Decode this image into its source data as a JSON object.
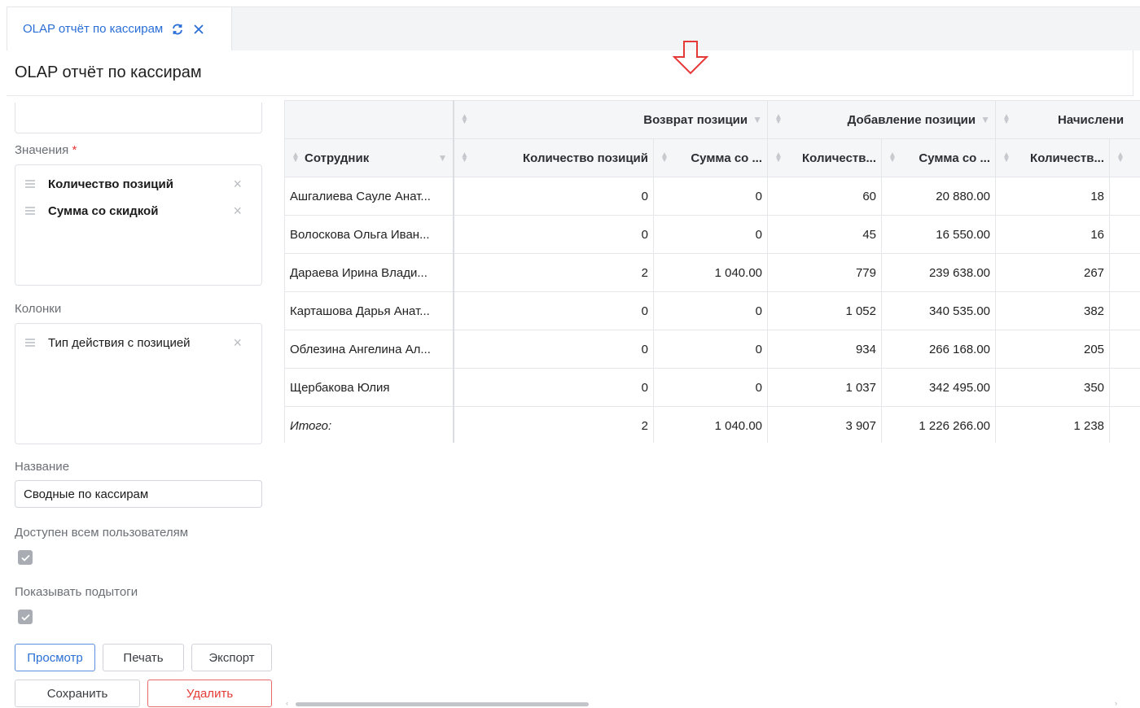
{
  "tab": {
    "label": "OLAP отчёт по кассирам",
    "refresh_icon": "refresh-icon",
    "close_icon": "close-icon"
  },
  "header": {
    "title": "OLAP отчёт по кассирам"
  },
  "panel": {
    "values_label": "Значения",
    "required_mark": "*",
    "values": [
      "Количество позиций",
      "Сумма со скидкой"
    ],
    "columns_label": "Колонки",
    "columns": [
      "Тип действия с позицией"
    ],
    "name_label": "Название",
    "name_value": "Сводные по кассирам",
    "shared_label": "Доступен всем пользователям",
    "shared_checked": true,
    "subtotals_label": "Показывать подытоги",
    "subtotals_checked": true,
    "buttons": {
      "view": "Просмотр",
      "print": "Печать",
      "export": "Экспорт",
      "save": "Сохранить",
      "delete": "Удалить"
    }
  },
  "table": {
    "groups": [
      "Возврат позиции",
      "Добавление позиции",
      "Начислени"
    ],
    "row_header": "Сотрудник",
    "columns": [
      "Количество позиций",
      "Сумма со ...",
      "Количеств...",
      "Сумма со ...",
      "Количеств..."
    ],
    "rows": [
      {
        "name": "Ашгалиева Сауле Анат...",
        "v": [
          "0",
          "0",
          "60",
          "20 880.00",
          "18"
        ]
      },
      {
        "name": "Волоскова Ольга Иван...",
        "v": [
          "0",
          "0",
          "45",
          "16 550.00",
          "16"
        ]
      },
      {
        "name": "Дараева Ирина Влади...",
        "v": [
          "2",
          "1 040.00",
          "779",
          "239 638.00",
          "267"
        ]
      },
      {
        "name": "Карташова Дарья Анат...",
        "v": [
          "0",
          "0",
          "1 052",
          "340 535.00",
          "382"
        ]
      },
      {
        "name": "Облезина Ангелина Ал...",
        "v": [
          "0",
          "0",
          "934",
          "266 168.00",
          "205"
        ]
      },
      {
        "name": "Щербакова Юлия",
        "v": [
          "0",
          "0",
          "1 037",
          "342 495.00",
          "350"
        ]
      }
    ],
    "total": {
      "name": "Итого:",
      "v": [
        "2",
        "1 040.00",
        "3 907",
        "1 226 266.00",
        "1 238"
      ]
    }
  },
  "colors": {
    "accent": "#2a6fd6",
    "danger": "#e53935",
    "arrow": "#e53935"
  }
}
